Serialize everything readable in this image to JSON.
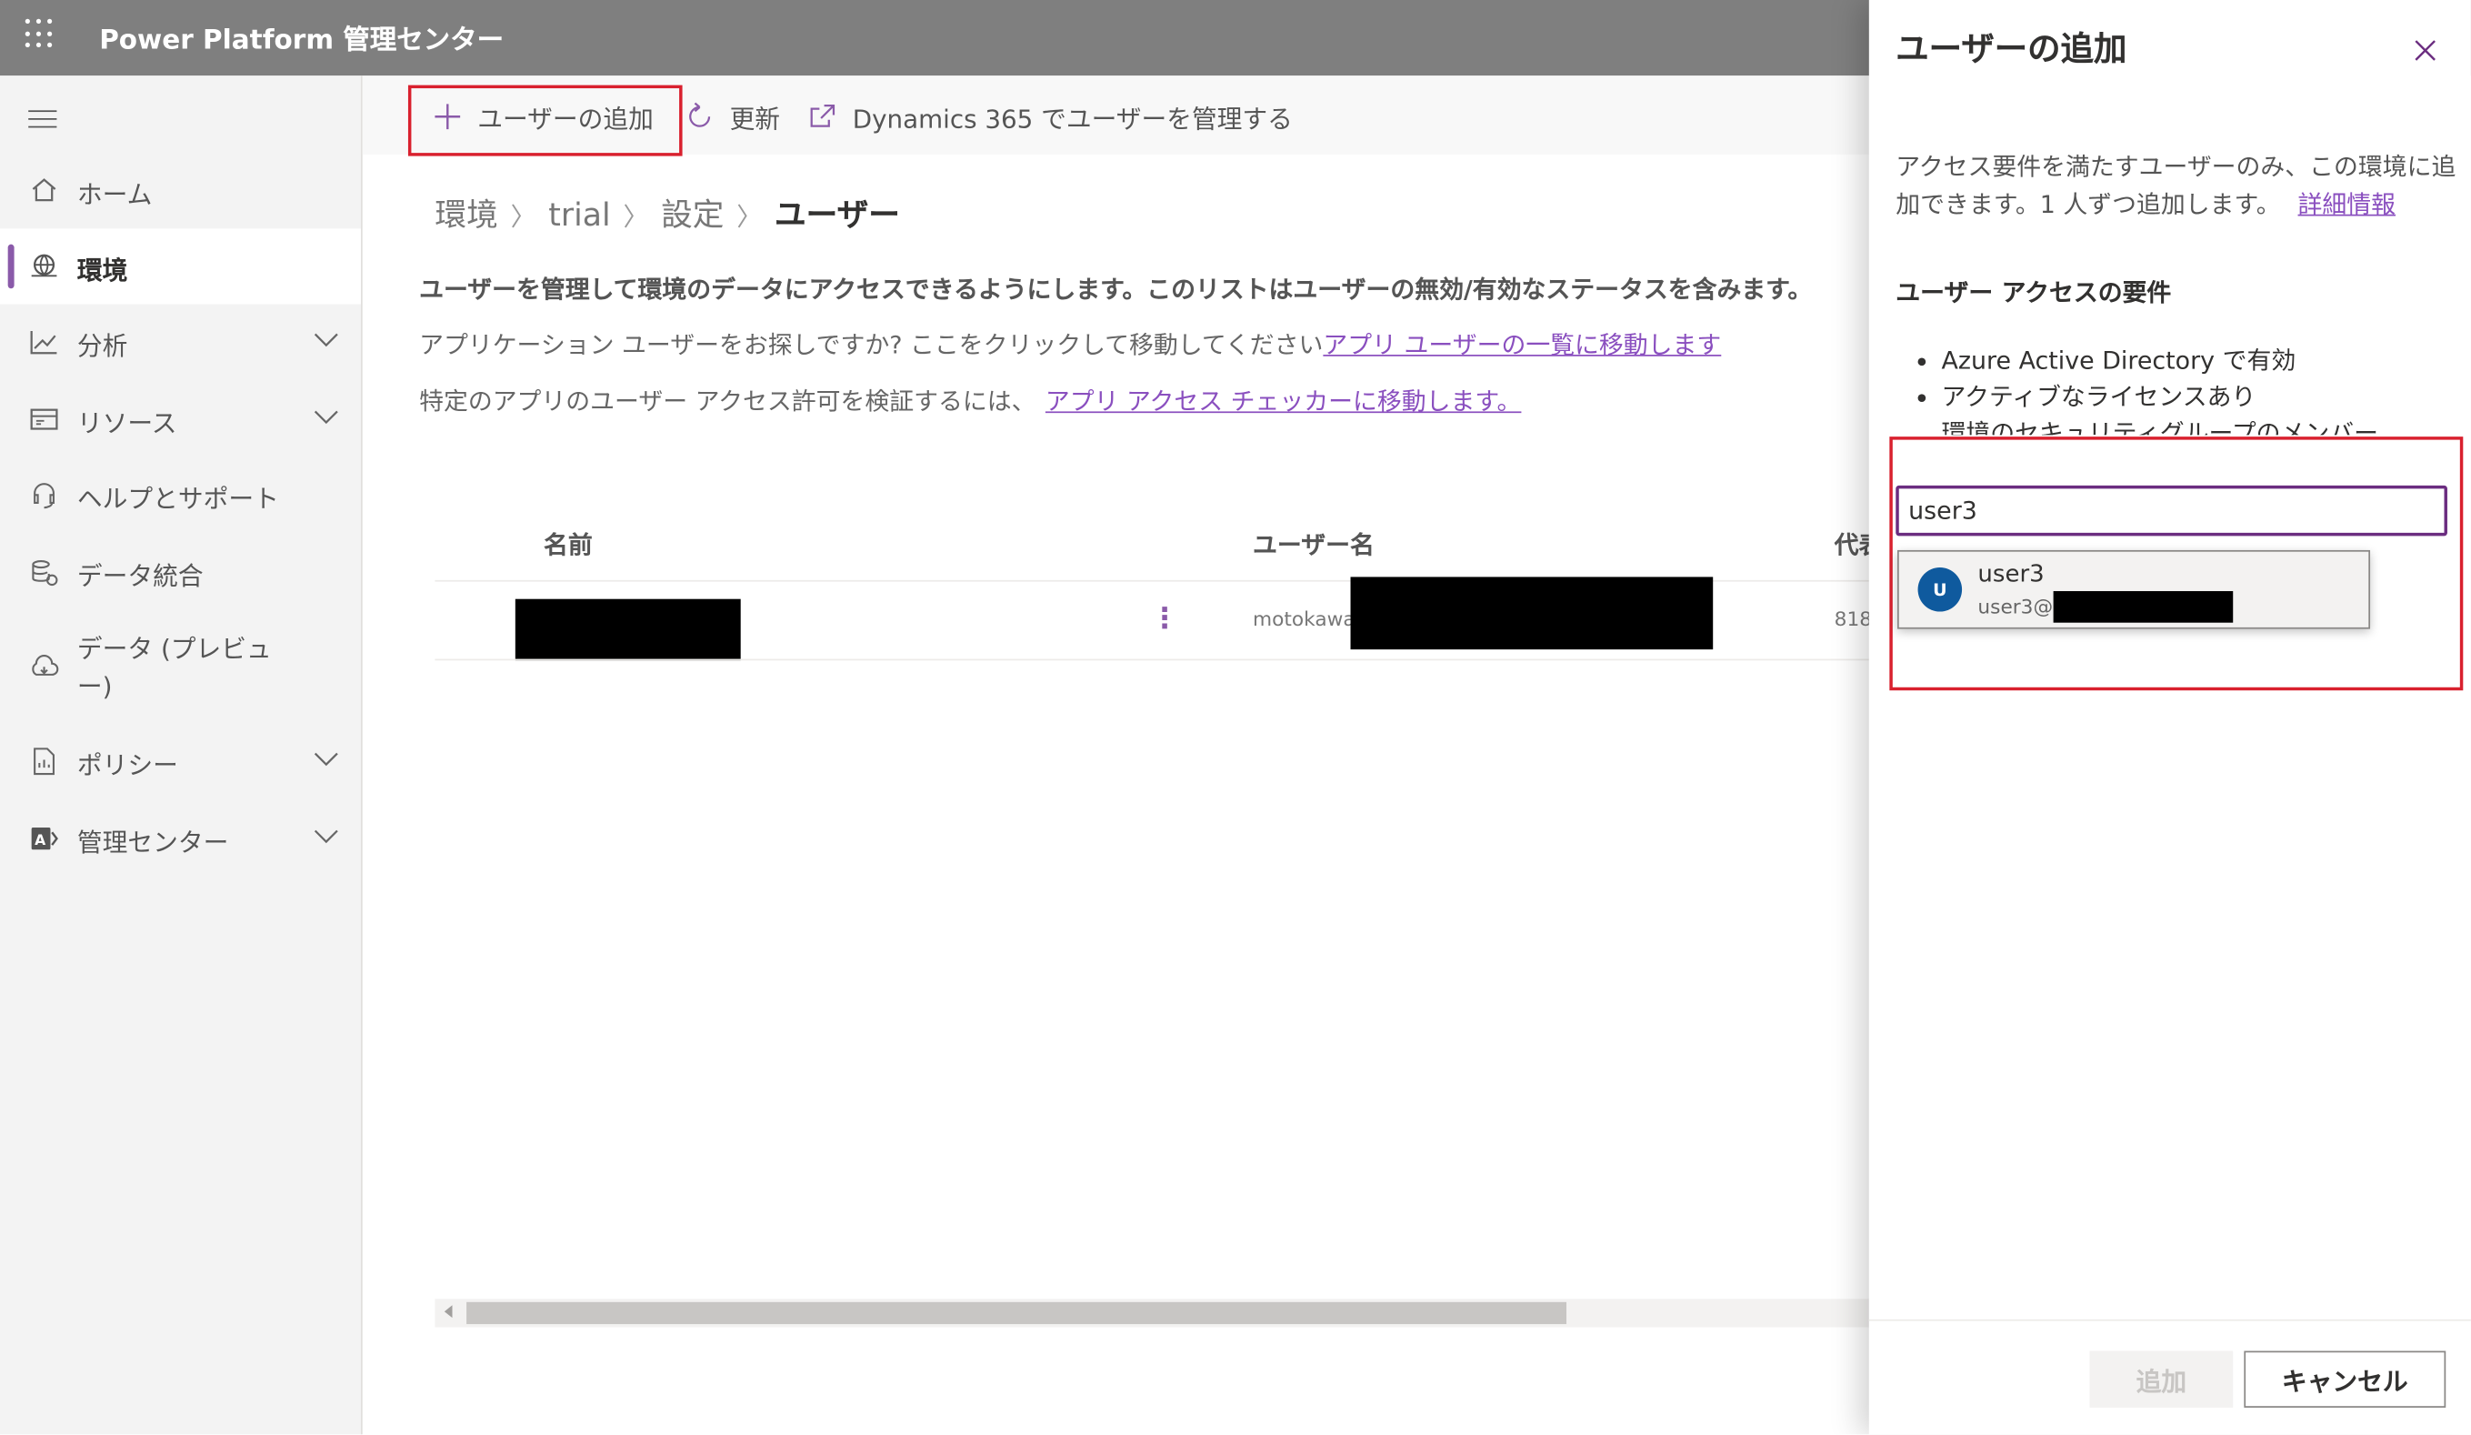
{
  "header": {
    "app_title": "Power Platform 管理センター"
  },
  "sidebar": {
    "items": [
      {
        "label": "ホーム",
        "icon": "home-icon"
      },
      {
        "label": "環境",
        "icon": "environment-icon",
        "active": true
      },
      {
        "label": "分析",
        "icon": "analytics-icon",
        "expandable": true
      },
      {
        "label": "リソース",
        "icon": "resources-icon",
        "expandable": true
      },
      {
        "label": "ヘルプとサポート",
        "icon": "headset-icon"
      },
      {
        "label": "データ統合",
        "icon": "data-integration-icon"
      },
      {
        "label": "データ (プレビュー)",
        "icon": "data-preview-icon"
      },
      {
        "label": "ポリシー",
        "icon": "policy-icon",
        "expandable": true
      },
      {
        "label": "管理センター",
        "icon": "admin-centers-icon",
        "expandable": true
      }
    ]
  },
  "commandbar": {
    "add_user": "ユーザーの追加",
    "refresh": "更新",
    "manage_d365": "Dynamics 365 でユーザーを管理する"
  },
  "breadcrumb": {
    "items": [
      "環境",
      "trial",
      "設定"
    ],
    "current": "ユーザー"
  },
  "main": {
    "description": "ユーザーを管理して環境のデータにアクセスできるようにします。このリストはユーザーの無効/有効なステータスを含みます。",
    "app_users_text": "アプリケーション ユーザーをお探しですか? ここをクリックして移動してください",
    "app_users_link": "アプリ ユーザーの一覧に移動します",
    "checker_text": "特定のアプリのユーザー アクセス許可を検証するには、",
    "checker_link": "アプリ アクセス チェッカーに移動します。"
  },
  "table": {
    "columns": [
      "名前",
      "ユーザー名",
      "代表"
    ],
    "rows": [
      {
        "username_prefix": "motokawa",
        "extra": "818"
      }
    ]
  },
  "panel": {
    "title": "ユーザーの追加",
    "description": "アクセス要件を満たすユーザーのみ、この環境に追加できます。1 人ずつ追加します。",
    "more_info": "詳細情報",
    "requirements_title": "ユーザー アクセスの要件",
    "requirements": [
      "Azure Active Directory で有効",
      "アクティブなライセンスあり",
      "環境のセキュリティグループのメンバー"
    ],
    "search_value": "user3",
    "suggestion": {
      "initial": "U",
      "name": "user3",
      "email_prefix": "user3@"
    },
    "add_button": "追加",
    "cancel_button": "キャンセル"
  },
  "colors": {
    "topbar": "#7f7f7f",
    "accent": "#8a5aa9",
    "highlight_box": "#d9202e",
    "avatar": "#0f5a9e"
  }
}
